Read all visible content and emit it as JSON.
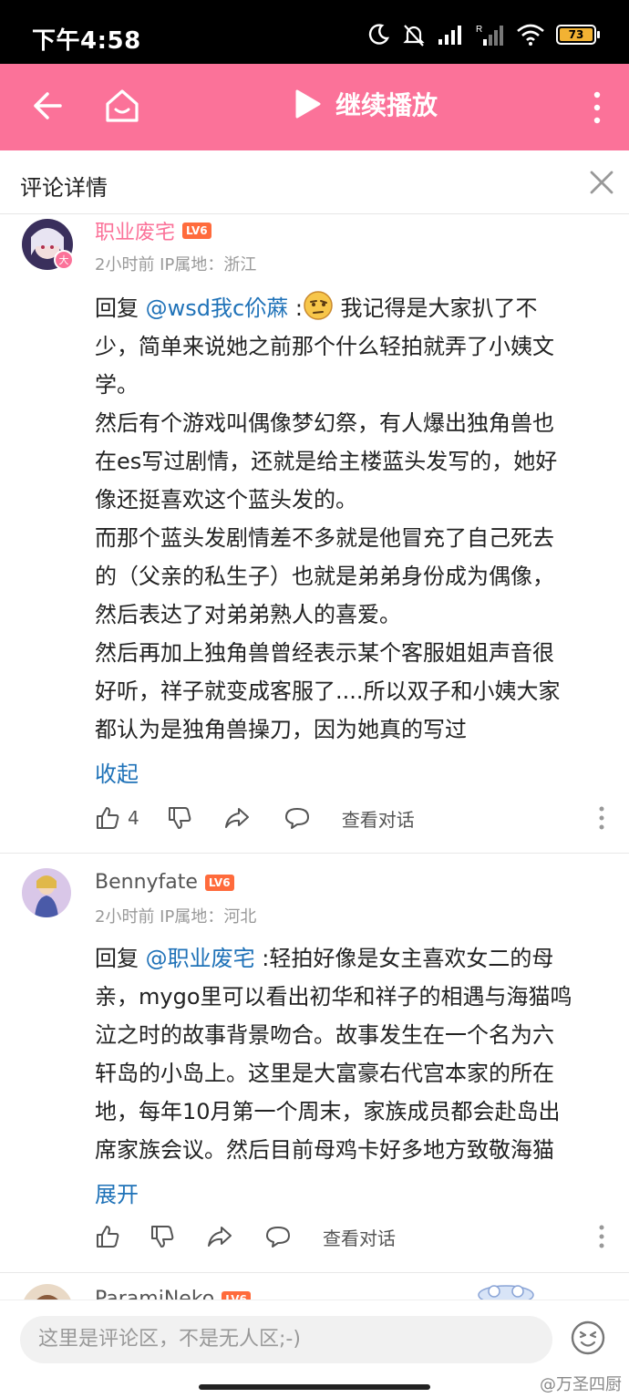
{
  "status_bar": {
    "time": "下午4:58",
    "battery": "73"
  },
  "app_bar": {
    "play_label": "继续播放"
  },
  "sub_header": {
    "title": "评论详情"
  },
  "comments": [
    {
      "username": "职业废宅",
      "level": "LV6",
      "meta": "2小时前 IP属地：浙江",
      "reply_prefix": "回复 ",
      "mention": "@wsd我c�New蔴",
      "mention_display": "@wsd我c伱蔴",
      "after_mention": " :",
      "text_lines": [
        " 我记得是大家扒了不",
        "少，简单来说她之前那个什么轻拍就弄了小姨文",
        "学。",
        "然后有个游戏叫偶像梦幻祭，有人爆出独角兽也",
        "在es写过剧情，还就是给主楼蓝头发写的，她好",
        "像还挺喜欢这个蓝头发的。",
        "而那个蓝头发剧情差不多就是他冒充了自己死去",
        "的（父亲的私生子）也就是弟弟身份成为偶像，",
        "然后表达了对弟弟熟人的喜爱。",
        "然后再加上独角兽曾经表示某个客服姐姐声音很",
        "好听，祥子就变成客服了....所以双子和小姨大家",
        "都认为是独角兽操刀，因为她真的写过"
      ],
      "toggle": "收起",
      "likes": "4",
      "view_conversation": "查看对话"
    },
    {
      "username": "Bennyfate",
      "level": "LV6",
      "meta": "2小时前 IP属地：河北",
      "reply_prefix": "回复 ",
      "mention_display": "@职业废宅",
      "after_mention": " :",
      "text_lines": [
        "轻拍好像是女主喜欢女二的母",
        "亲，mygo里可以看出初华和祥子的相遇与海猫鸣",
        "泣之时的故事背景吻合。故事发生在一个名为六",
        "轩岛的小岛上。这里是大富豪右代宫本家的所在",
        "地，每年10月第一个周末，家族成员都会赴岛出",
        "席家族会议。然后目前母鸡卡好多地方致敬海猫"
      ],
      "toggle": "展开",
      "likes": "",
      "view_conversation": "查看对话"
    },
    {
      "username": "ParamiNeko",
      "level": "LV6"
    }
  ],
  "bottom_bar": {
    "input_placeholder": "这里是评论区，不是无人区;-)",
    "watermark": "@万圣四厨"
  },
  "colors": {
    "brand_pink": "#fb7299",
    "mention_blue": "#1f72b8",
    "level_orange": "#ff6b3c"
  }
}
